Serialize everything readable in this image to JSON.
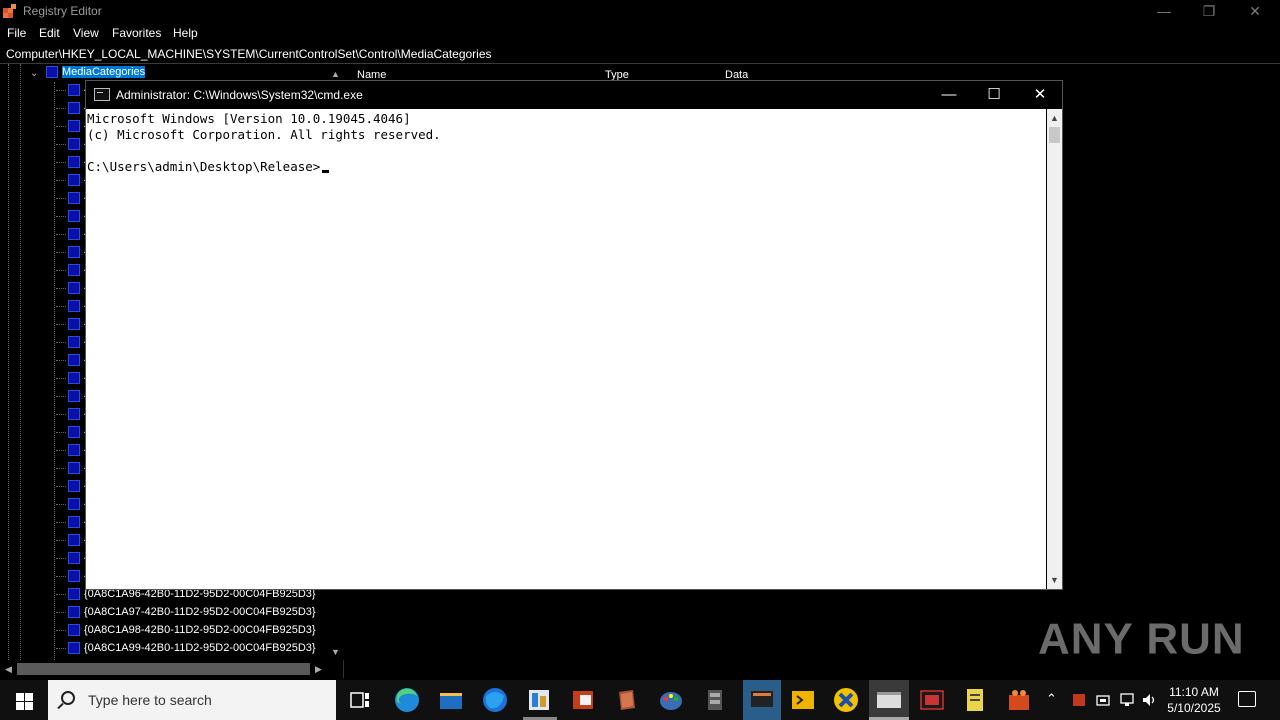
{
  "registry": {
    "title": "Registry Editor",
    "menu": [
      "File",
      "Edit",
      "View",
      "Favorites",
      "Help"
    ],
    "address": "Computer\\HKEY_LOCAL_MACHINE\\SYSTEM\\CurrentControlSet\\Control\\MediaCategories",
    "selected_key": "MediaCategories",
    "visible_keys": [
      "{0A8C1A96-42B0-11D2-95D2-00C04FB925D3}",
      "{0A8C1A97-42B0-11D2-95D2-00C04FB925D3}",
      "{0A8C1A98-42B0-11D2-95D2-00C04FB925D3}",
      "{0A8C1A99-42B0-11D2-95D2-00C04FB925D3}"
    ],
    "truncated_key_prefix": "{",
    "columns": [
      "Name",
      "Type",
      "Data"
    ]
  },
  "cmd": {
    "title": "Administrator: C:\\Windows\\System32\\cmd.exe",
    "lines": [
      "Microsoft Windows [Version 10.0.19045.4046]",
      "(c) Microsoft Corporation. All rights reserved.",
      "",
      "C:\\Users\\admin\\Desktop\\Release>"
    ]
  },
  "watermark": "ANY RUN",
  "taskbar": {
    "search_placeholder": "Type here to search",
    "time": "11:10 AM",
    "date": "5/10/2025"
  },
  "colors": {
    "selection": "#0078d7",
    "folder": "#0a0fa8",
    "cmd_background": "#ffffff"
  }
}
